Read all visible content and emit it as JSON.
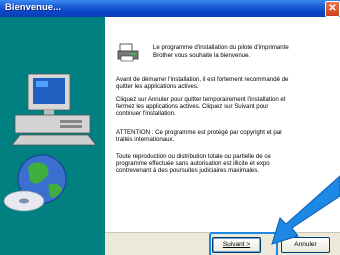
{
  "window": {
    "title": "Bienvenue...",
    "close_symbol": "✕"
  },
  "intro": {
    "line1": "Le programme d'installation du pilote d'imprimante",
    "line2": "Brother vous souhaite la bienvenue."
  },
  "paragraphs": {
    "p1": [
      "Avant de démarrer l'installation, il est fortement recommandé de",
      "quitter les applications actives."
    ],
    "p2": [
      "Cliquez sur Annuler pour quitter temporairement l'installation et",
      "fermez les applications actives. Cliquez sur Suivant pour",
      "continuer l'installation."
    ],
    "p3": [
      "ATTENTION : Ce programme est protégé par copyright et par",
      "traités internationaux."
    ],
    "p4": [
      "Toute reproduction ou distribution totale ou partielle de ce",
      "programme effectuée sans autorisation est illicite et expo",
      "contrevenant à des poursuites judiciaires maximales."
    ]
  },
  "buttons": {
    "next": "Suivant >",
    "cancel": "Annuler"
  },
  "colors": {
    "sidebar": "#008080",
    "titlebar": "#0a46c8",
    "highlight": "#1e88e5"
  }
}
